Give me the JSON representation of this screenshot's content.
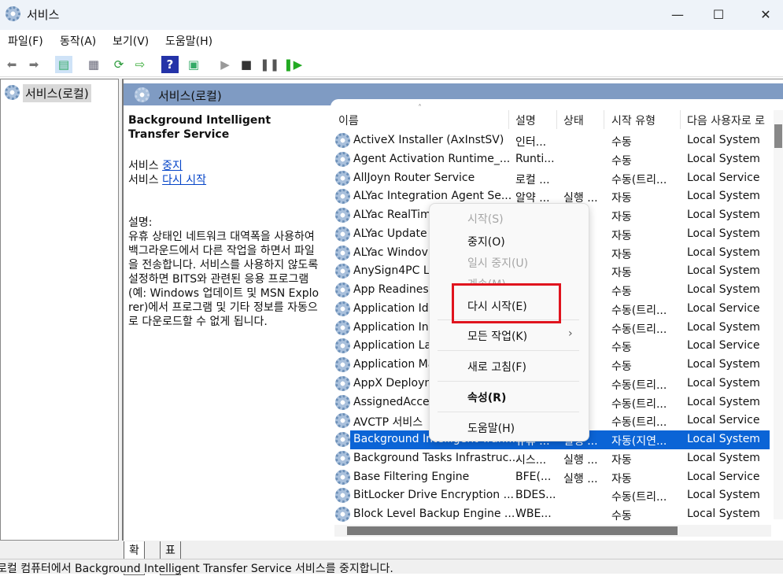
{
  "window": {
    "title": "서비스",
    "controls": [
      "—",
      "☐",
      "✕"
    ]
  },
  "menubar": [
    "파일(F)",
    "동작(A)",
    "보기(V)",
    "도움말(H)"
  ],
  "toolbar": [
    "back-icon",
    "forward-icon",
    "console-tree-icon",
    "properties-icon",
    "refresh-icon",
    "export-icon",
    "help-icon",
    "show-pane-icon",
    "start-icon",
    "stop-icon",
    "pause-icon",
    "resume-icon"
  ],
  "tree": {
    "root": "서비스(로컬)"
  },
  "panel": {
    "title": "서비스(로컬)"
  },
  "details": {
    "service_name": "Background Intelligent Transfer Service",
    "stop_prefix": "서비스",
    "stop_link": "중지",
    "restart_prefix": "서비스",
    "restart_link": "다시 시작",
    "desc_label": "설명:",
    "description": "유휴 상태인 네트워크 대역폭을 사용하여 백그라운드에서 다른 작업을 하면서 파일을 전송합니다. 서비스를 사용하지 않도록 설정하면 BITS와 관련된 응용 프로그램(예: Windows 업데이트 및 MSN Explorer)에서 프로그램 및 기타 정보를 자동으로 다운로드할 수 없게 됩니다."
  },
  "columns": [
    "이름",
    "설명",
    "상태",
    "시작 유형",
    "다음 사용자로 로"
  ],
  "rows": [
    {
      "name": "ActiveX Installer (AxInstSV)",
      "desc": "인터...",
      "status": "",
      "start": "수동",
      "logon": "Local System"
    },
    {
      "name": "Agent Activation Runtime_...",
      "desc": "Runti...",
      "status": "",
      "start": "수동",
      "logon": "Local System"
    },
    {
      "name": "AllJoyn Router Service",
      "desc": "로컬 ...",
      "status": "",
      "start": "수동(트리...",
      "logon": "Local Service"
    },
    {
      "name": "ALYac Integration Agent Se...",
      "desc": "알약 ...",
      "status": "실행 ...",
      "start": "자동",
      "logon": "Local System"
    },
    {
      "name": "ALYac RealTim",
      "desc": "",
      "status": "",
      "start": "자동",
      "logon": "Local System"
    },
    {
      "name": "ALYac Update",
      "desc": "",
      "status": "",
      "start": "자동",
      "logon": "Local System"
    },
    {
      "name": "ALYac Windov",
      "desc": "",
      "status": "",
      "start": "자동",
      "logon": "Local System"
    },
    {
      "name": "AnySign4PC La",
      "desc": "",
      "status": "",
      "start": "자동",
      "logon": "Local System"
    },
    {
      "name": "App Readiness",
      "desc": "",
      "status": "",
      "start": "수동",
      "logon": "Local System"
    },
    {
      "name": "Application Ide",
      "desc": "",
      "status": "",
      "start": "수동(트리...",
      "logon": "Local Service"
    },
    {
      "name": "Application Int",
      "desc": "",
      "status": "",
      "start": "수동(트리...",
      "logon": "Local System"
    },
    {
      "name": "Application La",
      "desc": "",
      "status": "",
      "start": "수동",
      "logon": "Local Service"
    },
    {
      "name": "Application Ma",
      "desc": "",
      "status": "",
      "start": "수동",
      "logon": "Local System"
    },
    {
      "name": "AppX Deployn",
      "desc": "",
      "status": "",
      "start": "수동(트리...",
      "logon": "Local System"
    },
    {
      "name": "AssignedAcces",
      "desc": "",
      "status": "",
      "start": "수동(트리...",
      "logon": "Local System"
    },
    {
      "name": "AVCTP 서비스",
      "desc": "",
      "status": "",
      "start": "수동(트리...",
      "logon": "Local Service"
    },
    {
      "name": "Background Intelligent Tran...",
      "desc": "유휴 ...",
      "status": "실행 ...",
      "start": "자동(지연...",
      "logon": "Local System",
      "selected": true
    },
    {
      "name": "Background Tasks Infrastruc...",
      "desc": "시스...",
      "status": "실행 ...",
      "start": "자동",
      "logon": "Local System"
    },
    {
      "name": "Base Filtering Engine",
      "desc": "BFE(...",
      "status": "실행 ...",
      "start": "자동",
      "logon": "Local Service"
    },
    {
      "name": "BitLocker Drive Encryption ...",
      "desc": "BDES...",
      "status": "",
      "start": "수동(트리...",
      "logon": "Local System"
    },
    {
      "name": "Block Level Backup Engine ...",
      "desc": "WBE...",
      "status": "",
      "start": "수동",
      "logon": "Local System"
    }
  ],
  "tabs": [
    "확장",
    "표준"
  ],
  "statusbar": "로컬 컴퓨터에서 Background Intelligent Transfer Service 서비스를 중지합니다.",
  "context_menu": [
    {
      "label": "시작(S)",
      "disabled": true
    },
    {
      "label": "중지(O)"
    },
    {
      "label": "일시 중지(U)",
      "disabled": true
    },
    {
      "label": "계속(M)",
      "disabled": true
    },
    {
      "label": "다시 시작(E)",
      "highlighted": true
    },
    {
      "label": "모든 작업(K)",
      "submenu": "›"
    },
    {
      "label": "새로 고침(F)"
    },
    {
      "label": "속성(R)",
      "bold": true
    },
    {
      "label": "도움말(H)"
    }
  ],
  "colors": {
    "selection": "#0b64d6",
    "highlight_box": "#e0141e",
    "panel_header": "#7f9bc3",
    "link": "#0645c8"
  }
}
